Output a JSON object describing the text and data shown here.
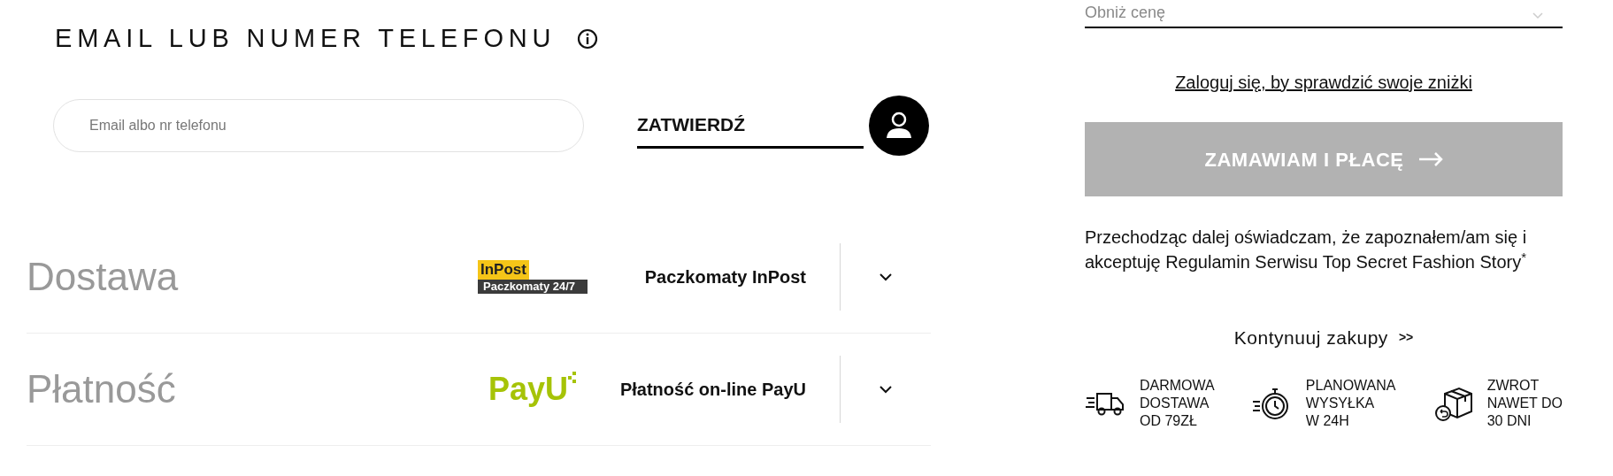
{
  "contact": {
    "title": "EMAIL LUB NUMER TELEFONU",
    "placeholder": "Email albo nr telefonu",
    "submit": "ZATWIERDŹ"
  },
  "options": [
    {
      "label": "Dostawa",
      "kind": "inpost",
      "logo_texts": [
        "InPost",
        "Paczkomaty 24/7"
      ],
      "value": "Paczkomaty InPost",
      "expanded": false
    },
    {
      "label": "Płatność",
      "kind": "payu",
      "logo_texts": [
        "PayU"
      ],
      "value": "Płatność on-line PayU",
      "expanded": false
    }
  ],
  "summary": {
    "discount_select": {
      "placeholder": "Obniż cenę"
    },
    "login_link": "Zaloguj się, by sprawdzić swoje zniżki",
    "order_button": {
      "label": "ZAMAWIAM I PŁACĘ",
      "disabled": true
    },
    "consent": "Przechodząc dalej oświadczam, że zapoznałem/am się i akceptuję Regulamin Serwisu Top Secret Fashion Story$^{*}$",
    "continue_link": "Kontynuuj zakupy",
    "continue_arrows": ">>"
  },
  "features": [
    {
      "kind": "truck",
      "lines": [
        "DARMOWA",
        "DOSTAWA",
        "OD 79ZŁ"
      ]
    },
    {
      "kind": "stopwatch",
      "lines": [
        "PLANOWANA",
        "WYSYŁKA",
        "W 24H"
      ]
    },
    {
      "kind": "box",
      "lines": [
        "ZWROT",
        "NAWET DO",
        "30 DNI"
      ]
    }
  ]
}
